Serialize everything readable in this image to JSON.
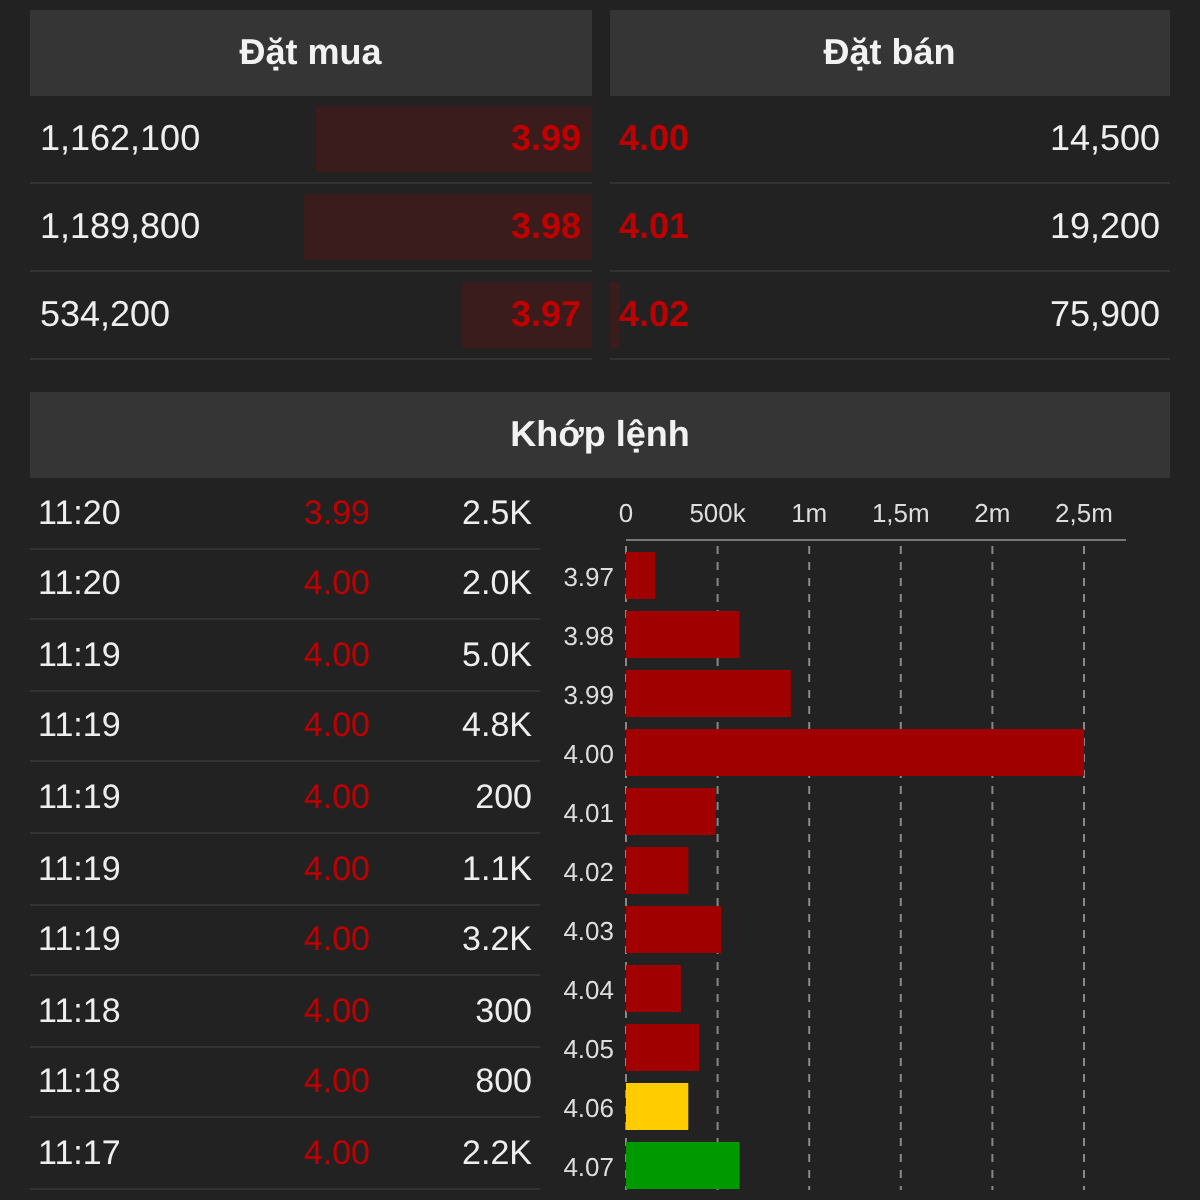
{
  "order_book": {
    "bid_title": "Đặt mua",
    "ask_title": "Đặt bán",
    "rows": [
      {
        "bid": {
          "volume": "1,162,100",
          "price": "3.99",
          "level": 0.49
        },
        "ask": {
          "price": "4.00",
          "volume": "14,500",
          "level": 0
        }
      },
      {
        "bid": {
          "volume": "1,189,800",
          "price": "3.98",
          "level": 0.51
        },
        "ask": {
          "price": "4.01",
          "volume": "19,200",
          "level": 0
        }
      },
      {
        "bid": {
          "volume": "534,200",
          "price": "3.97",
          "level": 0.23
        },
        "ask": {
          "price": "4.02",
          "volume": "75,900",
          "level": 0.02
        }
      }
    ]
  },
  "matched": {
    "title": "Khớp lệnh",
    "trades": [
      {
        "time": "11:20",
        "price": "3.99",
        "volume": "2.5K"
      },
      {
        "time": "11:20",
        "price": "4.00",
        "volume": "2.0K"
      },
      {
        "time": "11:19",
        "price": "4.00",
        "volume": "5.0K"
      },
      {
        "time": "11:19",
        "price": "4.00",
        "volume": "4.8K"
      },
      {
        "time": "11:19",
        "price": "4.00",
        "volume": "200"
      },
      {
        "time": "11:19",
        "price": "4.00",
        "volume": "1.1K"
      },
      {
        "time": "11:19",
        "price": "4.00",
        "volume": "3.2K"
      },
      {
        "time": "11:18",
        "price": "4.00",
        "volume": "300"
      },
      {
        "time": "11:18",
        "price": "4.00",
        "volume": "800"
      },
      {
        "time": "11:17",
        "price": "4.00",
        "volume": "2.2K"
      }
    ],
    "chart_data": {
      "type": "bar",
      "orientation": "horizontal",
      "grid": true,
      "categories": [
        "3.97",
        "3.98",
        "3.99",
        "4.00",
        "4.01",
        "4.02",
        "4.03",
        "4.04",
        "4.05",
        "4.06",
        "4.07"
      ],
      "series": [
        {
          "color": "#a00000",
          "values": [
            160000,
            620000,
            900000,
            2500000,
            490000,
            340000,
            520000,
            300000,
            400000,
            null,
            null
          ]
        },
        {
          "color": "#ffcc00",
          "values": [
            null,
            null,
            null,
            null,
            null,
            null,
            null,
            null,
            null,
            340000,
            null
          ]
        },
        {
          "color": "#009900",
          "values": [
            null,
            null,
            null,
            null,
            null,
            null,
            null,
            null,
            null,
            null,
            620000
          ]
        }
      ],
      "xlim": [
        0,
        2500000
      ],
      "xticks": [
        {
          "value": 0,
          "label": "0"
        },
        {
          "value": 500000,
          "label": "500k"
        },
        {
          "value": 1000000,
          "label": "1m"
        },
        {
          "value": 1500000,
          "label": "1,5m"
        },
        {
          "value": 2000000,
          "label": "2m"
        },
        {
          "value": 2500000,
          "label": "2,5m"
        }
      ]
    }
  }
}
